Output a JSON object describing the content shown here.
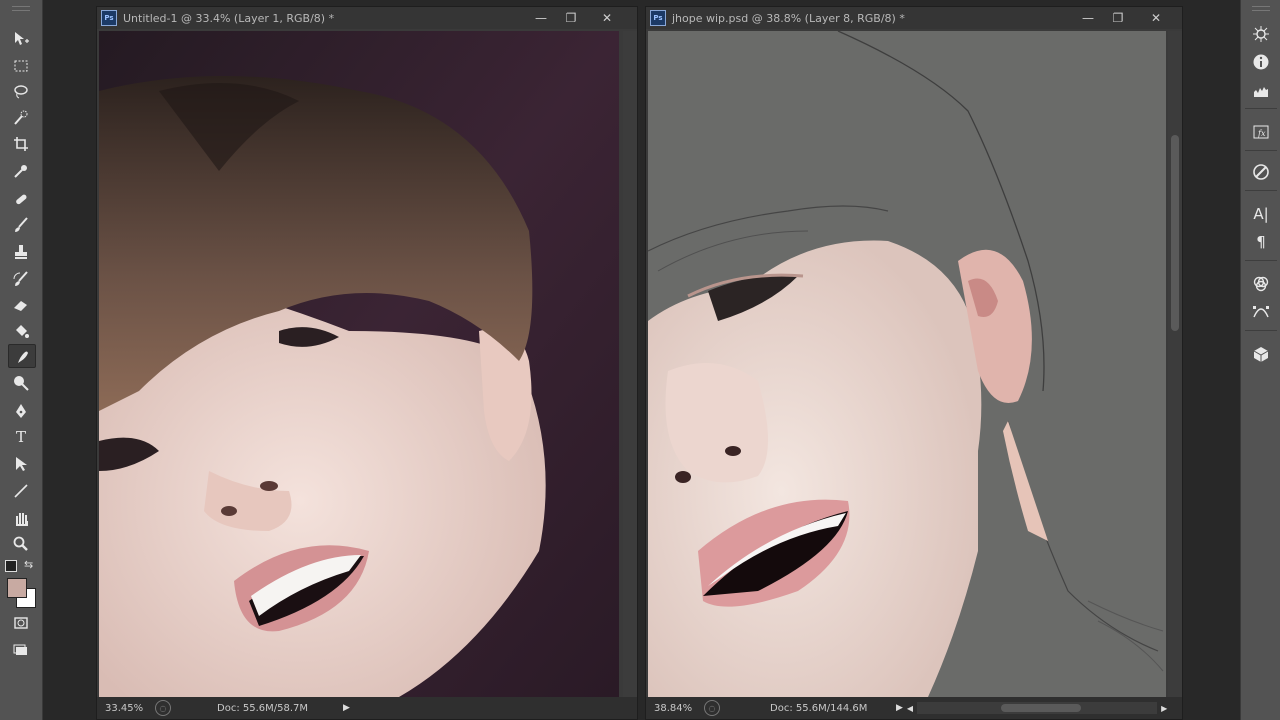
{
  "left_window": {
    "badge": "Ps",
    "title": "Untitled-1 @ 33.4% (Layer 1, RGB/8) *",
    "zoom": "33.45%",
    "doc": "Doc: 55.6M/58.7M"
  },
  "right_window": {
    "badge": "Ps",
    "title": "jhope wip.psd @ 38.8% (Layer 8, RGB/8) *",
    "zoom": "38.84%",
    "doc": "Doc: 55.6M/144.6M"
  },
  "window_controls": {
    "minimize": "—",
    "restore": "❐",
    "close": "✕"
  },
  "tools": [
    "move-tool-icon",
    "marquee-tool-icon",
    "lasso-tool-icon",
    "quick-select-tool-icon",
    "crop-tool-icon",
    "eyedropper-tool-icon",
    "healing-brush-icon",
    "brush-tool-icon",
    "clone-stamp-icon",
    "history-brush-icon",
    "eraser-tool-icon",
    "paint-bucket-icon",
    "smudge-tool-icon",
    "dodge-tool-icon",
    "pen-tool-icon",
    "type-tool-icon",
    "path-select-icon",
    "line-tool-icon",
    "hand-tool-icon",
    "zoom-tool-icon"
  ],
  "colors": {
    "foreground": "#c8aaa2",
    "background": "#ffffff",
    "canvas_gray": "#6a6b69"
  },
  "panels": [
    "navigator-icon",
    "info-icon",
    "histogram-icon",
    "styles-icon",
    "adjustments-icon",
    "character-icon",
    "paragraph-icon",
    "channels-icon",
    "paths-icon",
    "3d-icon"
  ],
  "panel_labels": {
    "character": "A|",
    "paragraph": "¶"
  },
  "tool_labels": {
    "type": "T"
  }
}
